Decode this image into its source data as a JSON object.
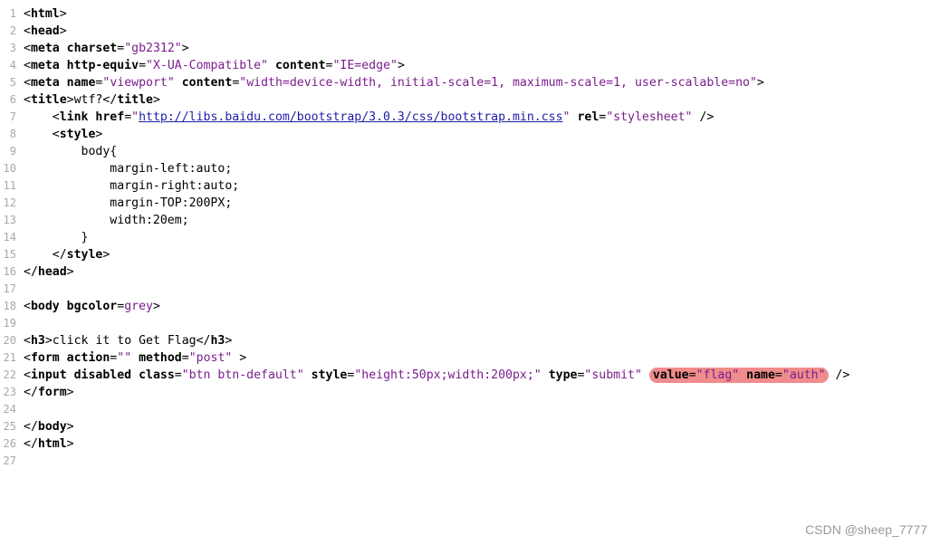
{
  "editor": {
    "lines": [
      {
        "num": "1",
        "indent": 0,
        "tokens": [
          {
            "t": "<",
            "c": "punct"
          },
          {
            "t": "html",
            "c": "tag"
          },
          {
            "t": ">",
            "c": "punct"
          }
        ]
      },
      {
        "num": "2",
        "indent": 0,
        "tokens": [
          {
            "t": "<",
            "c": "punct"
          },
          {
            "t": "head",
            "c": "tag"
          },
          {
            "t": ">",
            "c": "punct"
          }
        ]
      },
      {
        "num": "3",
        "indent": 0,
        "tokens": [
          {
            "t": "<",
            "c": "punct"
          },
          {
            "t": "meta ",
            "c": "tag"
          },
          {
            "t": "charset",
            "c": "attr"
          },
          {
            "t": "=",
            "c": "punct"
          },
          {
            "t": "\"gb2312\"",
            "c": "str"
          },
          {
            "t": ">",
            "c": "punct"
          }
        ]
      },
      {
        "num": "4",
        "indent": 0,
        "tokens": [
          {
            "t": "<",
            "c": "punct"
          },
          {
            "t": "meta ",
            "c": "tag"
          },
          {
            "t": "http-equiv",
            "c": "attr"
          },
          {
            "t": "=",
            "c": "punct"
          },
          {
            "t": "\"X-UA-Compatible\"",
            "c": "str"
          },
          {
            "t": " ",
            "c": "text"
          },
          {
            "t": "content",
            "c": "attr"
          },
          {
            "t": "=",
            "c": "punct"
          },
          {
            "t": "\"IE=edge\"",
            "c": "str"
          },
          {
            "t": ">",
            "c": "punct"
          }
        ]
      },
      {
        "num": "5",
        "indent": 0,
        "tokens": [
          {
            "t": "<",
            "c": "punct"
          },
          {
            "t": "meta ",
            "c": "tag"
          },
          {
            "t": "name",
            "c": "attr"
          },
          {
            "t": "=",
            "c": "punct"
          },
          {
            "t": "\"viewport\"",
            "c": "str"
          },
          {
            "t": " ",
            "c": "text"
          },
          {
            "t": "content",
            "c": "attr"
          },
          {
            "t": "=",
            "c": "punct"
          },
          {
            "t": "\"width=device-width, initial-scale=1, maximum-scale=1, user-scalable=no\"",
            "c": "str"
          },
          {
            "t": ">",
            "c": "punct"
          }
        ]
      },
      {
        "num": "6",
        "indent": 0,
        "tokens": [
          {
            "t": "<",
            "c": "punct"
          },
          {
            "t": "title",
            "c": "tag"
          },
          {
            "t": ">",
            "c": "punct"
          },
          {
            "t": "wtf?",
            "c": "text"
          },
          {
            "t": "</",
            "c": "punct"
          },
          {
            "t": "title",
            "c": "tag"
          },
          {
            "t": ">",
            "c": "punct"
          }
        ]
      },
      {
        "num": "7",
        "indent": 1,
        "tokens": [
          {
            "t": "<",
            "c": "punct"
          },
          {
            "t": "link ",
            "c": "tag"
          },
          {
            "t": "href",
            "c": "attr"
          },
          {
            "t": "=",
            "c": "punct"
          },
          {
            "t": "\"",
            "c": "str"
          },
          {
            "t": "http://libs.baidu.com/bootstrap/3.0.3/css/bootstrap.min.css",
            "c": "link"
          },
          {
            "t": "\"",
            "c": "str"
          },
          {
            "t": " ",
            "c": "text"
          },
          {
            "t": "rel",
            "c": "attr"
          },
          {
            "t": "=",
            "c": "punct"
          },
          {
            "t": "\"stylesheet\"",
            "c": "str"
          },
          {
            "t": " />",
            "c": "punct"
          }
        ]
      },
      {
        "num": "8",
        "indent": 1,
        "tokens": [
          {
            "t": "<",
            "c": "punct"
          },
          {
            "t": "style",
            "c": "tag"
          },
          {
            "t": ">",
            "c": "punct"
          }
        ]
      },
      {
        "num": "9",
        "indent": 2,
        "tokens": [
          {
            "t": "body{",
            "c": "text"
          }
        ]
      },
      {
        "num": "10",
        "indent": 3,
        "tokens": [
          {
            "t": "margin-left:auto;",
            "c": "text"
          }
        ]
      },
      {
        "num": "11",
        "indent": 3,
        "tokens": [
          {
            "t": "margin-right:auto;",
            "c": "text"
          }
        ]
      },
      {
        "num": "12",
        "indent": 3,
        "tokens": [
          {
            "t": "margin-TOP:200PX;",
            "c": "text"
          }
        ]
      },
      {
        "num": "13",
        "indent": 3,
        "tokens": [
          {
            "t": "width:20em;",
            "c": "text"
          }
        ]
      },
      {
        "num": "14",
        "indent": 2,
        "tokens": [
          {
            "t": "}",
            "c": "text"
          }
        ]
      },
      {
        "num": "15",
        "indent": 1,
        "tokens": [
          {
            "t": "</",
            "c": "punct"
          },
          {
            "t": "style",
            "c": "tag"
          },
          {
            "t": ">",
            "c": "punct"
          }
        ]
      },
      {
        "num": "16",
        "indent": 0,
        "tokens": [
          {
            "t": "</",
            "c": "punct"
          },
          {
            "t": "head",
            "c": "tag"
          },
          {
            "t": ">",
            "c": "punct"
          }
        ]
      },
      {
        "num": "17",
        "indent": 0,
        "tokens": []
      },
      {
        "num": "18",
        "indent": 0,
        "tokens": [
          {
            "t": "<",
            "c": "punct"
          },
          {
            "t": "body ",
            "c": "tag"
          },
          {
            "t": "bgcolor",
            "c": "attr"
          },
          {
            "t": "=",
            "c": "punct"
          },
          {
            "t": "grey",
            "c": "str"
          },
          {
            "t": ">",
            "c": "punct"
          }
        ]
      },
      {
        "num": "19",
        "indent": 0,
        "tokens": []
      },
      {
        "num": "20",
        "indent": 0,
        "tokens": [
          {
            "t": "<",
            "c": "punct"
          },
          {
            "t": "h3",
            "c": "tag"
          },
          {
            "t": ">",
            "c": "punct"
          },
          {
            "t": "click it to Get Flag",
            "c": "text"
          },
          {
            "t": "</",
            "c": "punct"
          },
          {
            "t": "h3",
            "c": "tag"
          },
          {
            "t": ">",
            "c": "punct"
          }
        ]
      },
      {
        "num": "21",
        "indent": 0,
        "tokens": [
          {
            "t": "<",
            "c": "punct"
          },
          {
            "t": "form ",
            "c": "tag"
          },
          {
            "t": "action",
            "c": "attr"
          },
          {
            "t": "=",
            "c": "punct"
          },
          {
            "t": "\"\"",
            "c": "str"
          },
          {
            "t": " ",
            "c": "text"
          },
          {
            "t": "method",
            "c": "attr"
          },
          {
            "t": "=",
            "c": "punct"
          },
          {
            "t": "\"post\"",
            "c": "str"
          },
          {
            "t": " >",
            "c": "punct"
          }
        ]
      },
      {
        "num": "22",
        "indent": 0,
        "tokens": [
          {
            "t": "<",
            "c": "punct"
          },
          {
            "t": "input ",
            "c": "tag"
          },
          {
            "t": "disabled ",
            "c": "attr"
          },
          {
            "t": "class",
            "c": "attr"
          },
          {
            "t": "=",
            "c": "punct"
          },
          {
            "t": "\"btn btn-default\"",
            "c": "str"
          },
          {
            "t": " ",
            "c": "text"
          },
          {
            "t": "style",
            "c": "attr"
          },
          {
            "t": "=",
            "c": "punct"
          },
          {
            "t": "\"height:50px;width:200px;\"",
            "c": "str"
          },
          {
            "t": " ",
            "c": "text"
          },
          {
            "t": "type",
            "c": "attr"
          },
          {
            "t": "=",
            "c": "punct"
          },
          {
            "t": "\"submit\"",
            "c": "str"
          },
          {
            "t": " ",
            "c": "text"
          },
          {
            "t": "HL_START",
            "c": "hl"
          },
          {
            "t": "value",
            "c": "attr"
          },
          {
            "t": "=",
            "c": "punct"
          },
          {
            "t": "\"flag\"",
            "c": "str"
          },
          {
            "t": " ",
            "c": "text"
          },
          {
            "t": "name",
            "c": "attr"
          },
          {
            "t": "=",
            "c": "punct"
          },
          {
            "t": "\"auth\"",
            "c": "str"
          },
          {
            "t": "HL_END",
            "c": "hl"
          },
          {
            "t": " />",
            "c": "punct"
          }
        ]
      },
      {
        "num": "23",
        "indent": 0,
        "tokens": [
          {
            "t": "</",
            "c": "punct"
          },
          {
            "t": "form",
            "c": "tag"
          },
          {
            "t": ">",
            "c": "punct"
          }
        ]
      },
      {
        "num": "24",
        "indent": 0,
        "tokens": []
      },
      {
        "num": "25",
        "indent": 0,
        "tokens": [
          {
            "t": "</",
            "c": "punct"
          },
          {
            "t": "body",
            "c": "tag"
          },
          {
            "t": ">",
            "c": "punct"
          }
        ]
      },
      {
        "num": "26",
        "indent": 0,
        "tokens": [
          {
            "t": "</",
            "c": "punct"
          },
          {
            "t": "html",
            "c": "tag"
          },
          {
            "t": ">",
            "c": "punct"
          }
        ]
      },
      {
        "num": "27",
        "indent": 0,
        "tokens": []
      }
    ],
    "highlight_color": "#f08c8c",
    "string_color": "#7a1e8c",
    "link_color": "#1c1ca8"
  },
  "watermark": {
    "text": "CSDN @sheep_7777"
  }
}
